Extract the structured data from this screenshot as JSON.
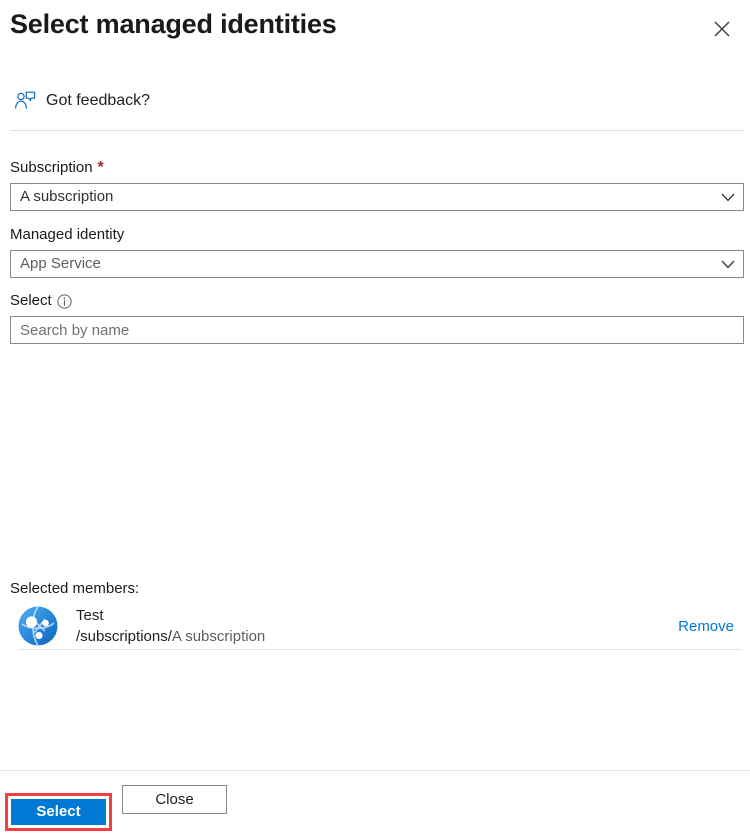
{
  "dialog": {
    "title": "Select managed identities",
    "close_icon": "close-icon"
  },
  "feedback": {
    "label": "Got feedback?",
    "icon": "feedback-person-icon"
  },
  "form": {
    "subscription": {
      "label": "Subscription",
      "required_marker": "*",
      "value": "A subscription",
      "chevron_icon": "chevron-down-icon"
    },
    "managed_identity": {
      "label": "Managed identity",
      "value": "App Service",
      "chevron_icon": "chevron-down-icon"
    },
    "select": {
      "label": "Select",
      "info_icon": "info-icon",
      "search_placeholder": "Search by name",
      "search_value": ""
    }
  },
  "selected_members": {
    "title": "Selected members:",
    "members": [
      {
        "avatar_icon": "managed-identity-avatar-icon",
        "name": "Test",
        "path": "/subscriptions/",
        "subscription": "A subscription",
        "remove_label": "Remove"
      }
    ]
  },
  "footer": {
    "select_label": "Select",
    "close_label": "Close"
  },
  "colors": {
    "accent": "#0078d4",
    "link": "#0078d4",
    "required": "#a4262c",
    "highlight_annotation": "#f53d3d",
    "border": "#8a8886",
    "divider": "#e1dfdd",
    "text": "#1b1a19",
    "muted_text": "#605e5c"
  }
}
